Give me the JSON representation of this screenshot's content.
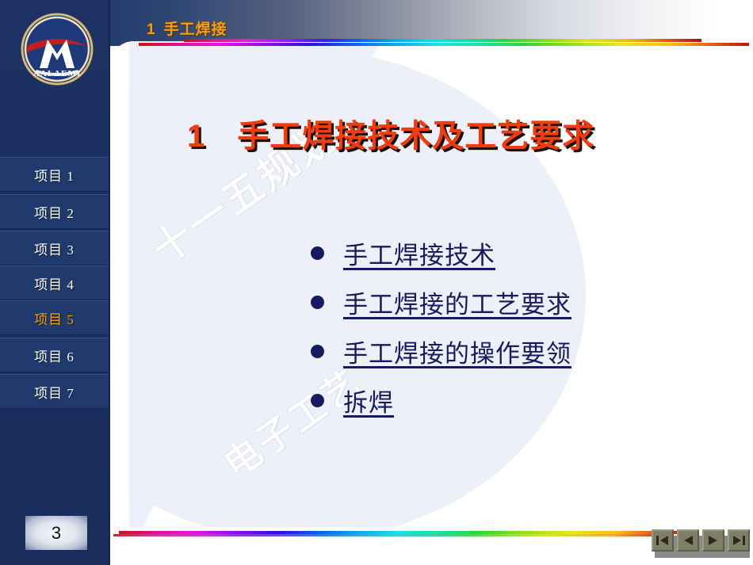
{
  "slide": {
    "header_number": "1",
    "header_title": "手工焊接",
    "page_number": "3"
  },
  "title": {
    "number": "1",
    "line1": "手工焊接技术及工艺",
    "line2": "要求"
  },
  "bullets": [
    {
      "label": "手工焊接技术"
    },
    {
      "label": "手工焊接的工艺要求"
    },
    {
      "label": "手工焊接的操作要领"
    },
    {
      "label": "拆焊"
    }
  ],
  "sidebar": {
    "logo_text": "AAI AEMI",
    "items": [
      {
        "label": "项目 1",
        "active": false
      },
      {
        "label": "项目 2",
        "active": false
      },
      {
        "label": "项目 3",
        "active": false
      },
      {
        "label": "项目 4",
        "active": false
      },
      {
        "label": "项目 5",
        "active": true
      },
      {
        "label": "项目 6",
        "active": false
      },
      {
        "label": "项目 7",
        "active": false
      }
    ]
  },
  "watermarks": {
    "line1": "十一五规划",
    "line2": "电子工艺"
  },
  "nav": {
    "first": "首页",
    "prev": "上一页",
    "next": "下一页",
    "last": "末页"
  },
  "colors": {
    "sidebar_navy": "#1d3263",
    "accent_orange": "#f0a020",
    "title_red": "#f23c10",
    "link_navy": "#151b5e",
    "active_item": "#f5a11a"
  }
}
